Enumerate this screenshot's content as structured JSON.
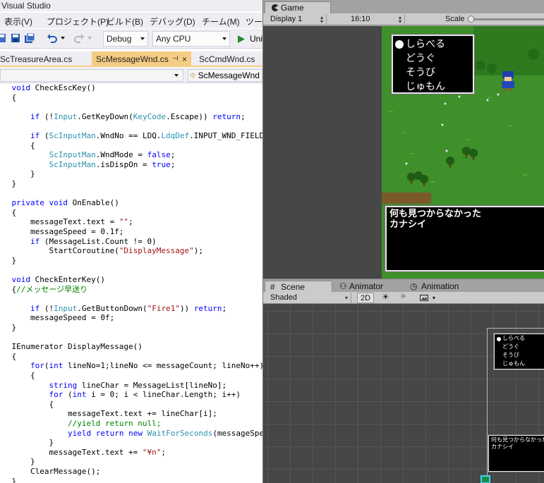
{
  "vs": {
    "title": "Visual Studio",
    "menu": [
      "表示(V)",
      "プロジェクト(P)",
      "ビルド(B)",
      "デバッグ(D)",
      "チーム(M)",
      "ツー"
    ],
    "toolbar": {
      "config": "Debug",
      "platform": "Any CPU",
      "run_label": "Uni"
    },
    "tabs": [
      "ScTreasureArea.cs",
      "ScMessageWnd.cs",
      "ScCmdWnd.cs"
    ],
    "active_tab_pin": "⊣",
    "nav_member": "ScMessageWnd",
    "code": [
      {
        "t": "    void CheckEscKey()",
        "cls": "kw-first"
      },
      {
        "t": "    {"
      },
      {
        "t": ""
      },
      {
        "t": "        if (!Input.GetKeyDown(KeyCode.Escape)) return;"
      },
      {
        "t": ""
      },
      {
        "t": "        if (ScInputMan.WndNo == LDQ.LdqDef.INPUT_WND_FIELD_MS"
      },
      {
        "t": "        {"
      },
      {
        "t": "            ScInputMan.WndMode = false;"
      },
      {
        "t": "            ScInputMan.isDispOn = true;"
      },
      {
        "t": "        }"
      },
      {
        "t": "    }"
      },
      {
        "t": ""
      },
      {
        "t": "    private void OnEnable()"
      },
      {
        "t": "    {"
      },
      {
        "t": "        messageText.text = \"\";"
      },
      {
        "t": "        messageSpeed = 0.1f;"
      },
      {
        "t": "        if (MessageList.Count != 0)"
      },
      {
        "t": "            StartCoroutine(\"DisplayMessage\");"
      },
      {
        "t": "    }"
      },
      {
        "t": ""
      },
      {
        "t": "    void CheckEnterKey()"
      },
      {
        "t": "    {//メッセージ早送り"
      },
      {
        "t": ""
      },
      {
        "t": "        if (!Input.GetButtonDown(\"Fire1\")) return;"
      },
      {
        "t": "        messageSpeed = 0f;"
      },
      {
        "t": "    }"
      },
      {
        "t": ""
      },
      {
        "t": "    IEnumerator DisplayMessage()"
      },
      {
        "t": "    {"
      },
      {
        "t": "        for(int lineNo=1;lineNo <= messageCount; lineNo++)"
      },
      {
        "t": "        {"
      },
      {
        "t": "            string lineChar = MessageList[lineNo];"
      },
      {
        "t": "            for (int i = 0; i < lineChar.Length; i++)"
      },
      {
        "t": "            {"
      },
      {
        "t": "                messageText.text += lineChar[i];"
      },
      {
        "t": "                //yield return null;"
      },
      {
        "t": "                yield return new WaitForSeconds(messageSpeed)"
      },
      {
        "t": "            }"
      },
      {
        "t": "            messageText.text += \"¥n\";"
      },
      {
        "t": "        }"
      },
      {
        "t": "        ClearMessage();"
      },
      {
        "t": "    }"
      }
    ]
  },
  "unity": {
    "game_tab": "Game",
    "display": "Display 1",
    "aspect": "16:10",
    "scale_label": "Scale",
    "command_menu": [
      "しらべる",
      "どうぐ",
      "そうび",
      "じゅもん"
    ],
    "message_lines": [
      "何も見つからなかった",
      "カナシイ"
    ],
    "scene_tabs": [
      "Scene",
      "Animator",
      "Animation"
    ],
    "shading": "Shaded",
    "mode_2d": "2D",
    "colors": {
      "grass": "#3f8f2a",
      "window_bg": "#000000",
      "window_border": "#e8e8e8",
      "vs_active_tab": "#f5cc84"
    }
  }
}
